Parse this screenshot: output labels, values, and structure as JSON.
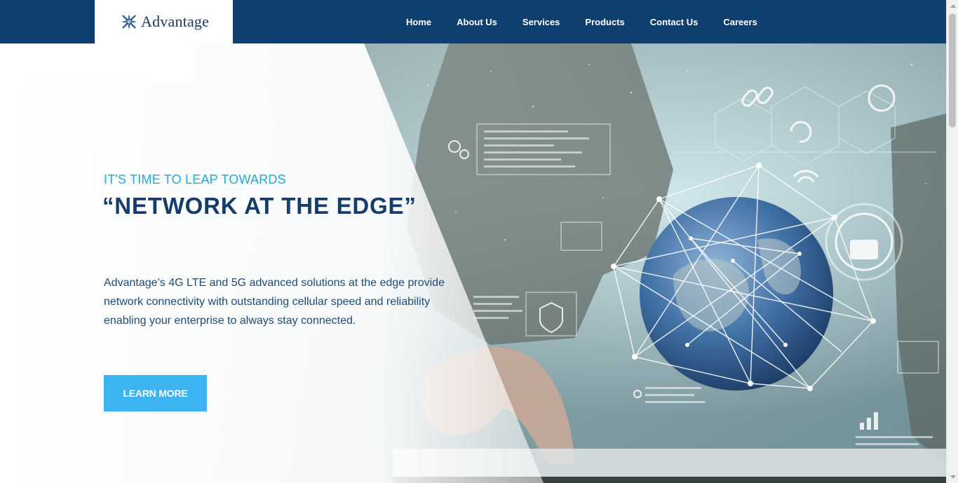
{
  "brand": {
    "name": "Advantage",
    "logo_icon": "advantage-star-logo",
    "colors": {
      "navbar": "#0f3f6e",
      "accent": "#25a9d9",
      "headline": "#163c6b",
      "button": "#3bb4f1"
    }
  },
  "nav": {
    "items": [
      {
        "label": "Home"
      },
      {
        "label": "About Us"
      },
      {
        "label": "Services"
      },
      {
        "label": "Products"
      },
      {
        "label": "Contact Us"
      },
      {
        "label": "Careers"
      }
    ]
  },
  "hero": {
    "eyebrow": "IT'S TIME TO LEAP TOWARDS",
    "headline": "“NETWORK AT THE EDGE”",
    "body": "Advantage’s 4G LTE and 5G advanced solutions at the edge provide network connectivity with outstanding cellular speed and reliability enabling your enterprise to always stay connected.",
    "cta_label": "LEARN MORE",
    "background_image": "network-globe-hand-touch-image"
  }
}
